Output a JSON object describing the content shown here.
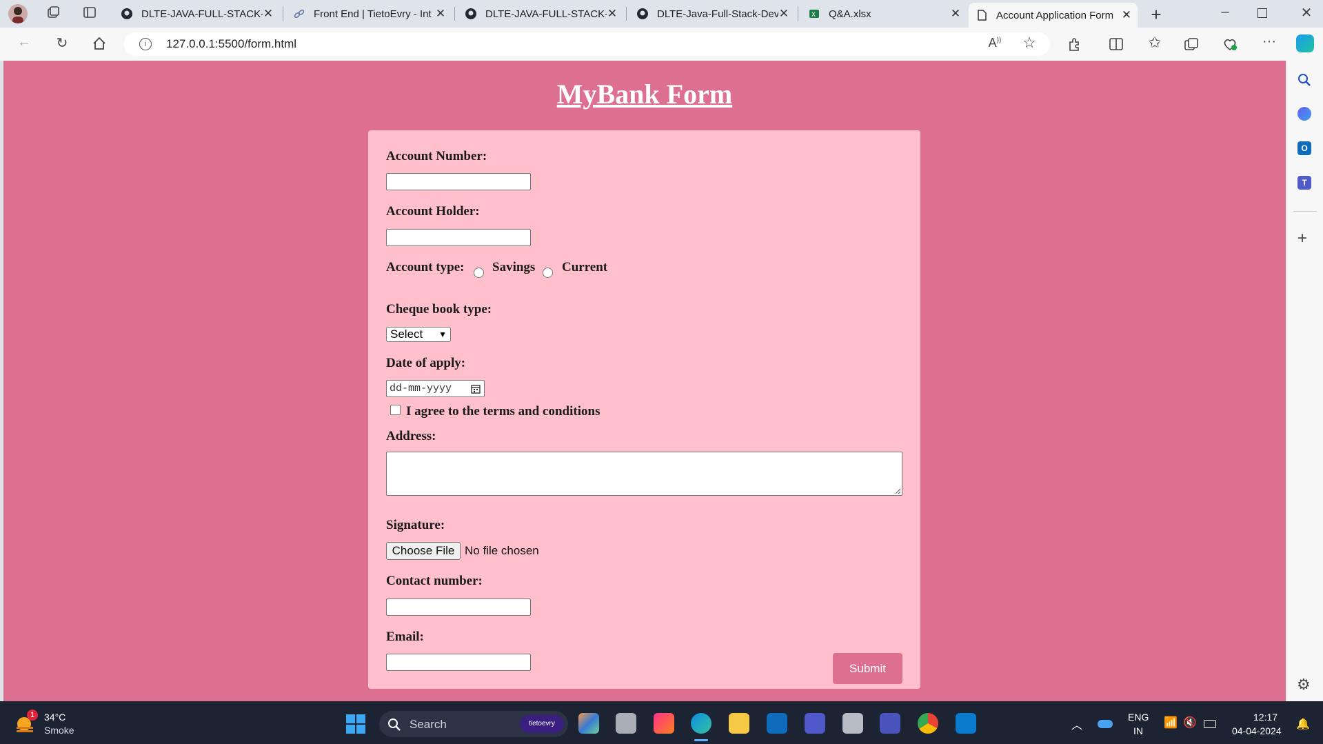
{
  "browser": {
    "tabs": [
      {
        "label": "DLTE-JAVA-FULL-STACK-S",
        "icon": "github-icon"
      },
      {
        "label": "Front End | TietoEvry - Int",
        "icon": "link-icon"
      },
      {
        "label": "DLTE-JAVA-FULL-STACK-S",
        "icon": "github-icon"
      },
      {
        "label": "DLTE-Java-Full-Stack-Dev",
        "icon": "github-icon"
      },
      {
        "label": "Q&A.xlsx",
        "icon": "excel-icon"
      },
      {
        "label": "Account Application Form",
        "icon": "page-icon"
      }
    ],
    "url": "127.0.0.1:5500/form.html"
  },
  "form": {
    "title": "MyBank Form",
    "account_number_label": "Account Number:",
    "account_holder_label": "Account Holder:",
    "account_type_label": "Account type:",
    "account_type_options": [
      "Savings",
      "Current"
    ],
    "cheque_book_label": "Cheque book type:",
    "cheque_book_selected": "Select",
    "date_label": "Date of apply:",
    "date_placeholder": "dd-mm-yyyy",
    "terms_label": "I agree to the terms and conditions",
    "address_label": "Address:",
    "signature_label": "Signature:",
    "file_button": "Choose File",
    "file_status": "No file chosen",
    "contact_label": "Contact number:",
    "email_label": "Email:",
    "submit_label": "Submit"
  },
  "taskbar": {
    "weather_temp": "34°C",
    "weather_desc": "Smoke",
    "weather_badge": "1",
    "search_placeholder": "Search",
    "search_chip": "tietoevry",
    "lang_line1": "ENG",
    "lang_line2": "IN",
    "time": "12:17",
    "date": "04-04-2024"
  },
  "colors": {
    "page_bg": "#dd7090",
    "form_bg": "#ffbfcb",
    "submit_bg": "#dd7090"
  }
}
